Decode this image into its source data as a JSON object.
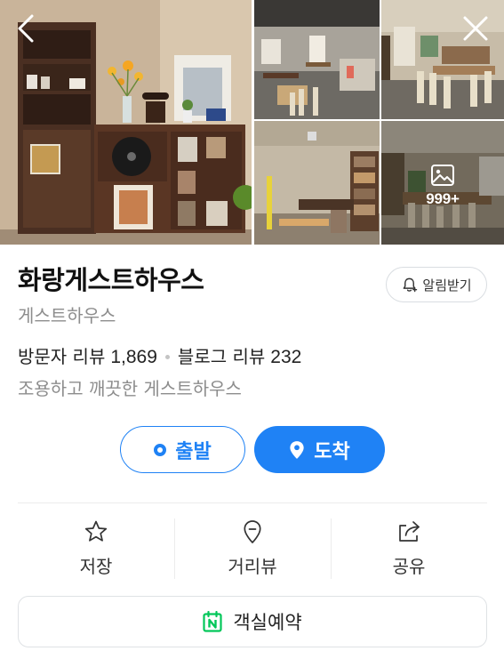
{
  "gallery": {
    "more_count": "999+"
  },
  "place": {
    "name": "화랑게스트하우스",
    "category": "게스트하우스",
    "alarm_label": "알림받기",
    "visitor_review_label": "방문자 리뷰",
    "visitor_review_count": "1,869",
    "blog_review_label": "블로그 리뷰",
    "blog_review_count": "232",
    "description": "조용하고 깨끗한 게스트하우스"
  },
  "route": {
    "depart_label": "출발",
    "arrive_label": "도착"
  },
  "actions": {
    "save_label": "저장",
    "street_label": "거리뷰",
    "share_label": "공유"
  },
  "booking": {
    "label": "객실예약"
  },
  "colors": {
    "accent": "#1f82f5",
    "booking_icon": "#03c75a",
    "muted_text": "#8d8d8d"
  },
  "icons": {
    "back": "chevron-left-icon",
    "close": "close-icon",
    "alarm": "bell-plus-icon",
    "save": "star-icon",
    "street": "map-pin-icon",
    "share": "share-icon",
    "booking": "naver-calendar-icon",
    "more_photos": "image-icon"
  }
}
